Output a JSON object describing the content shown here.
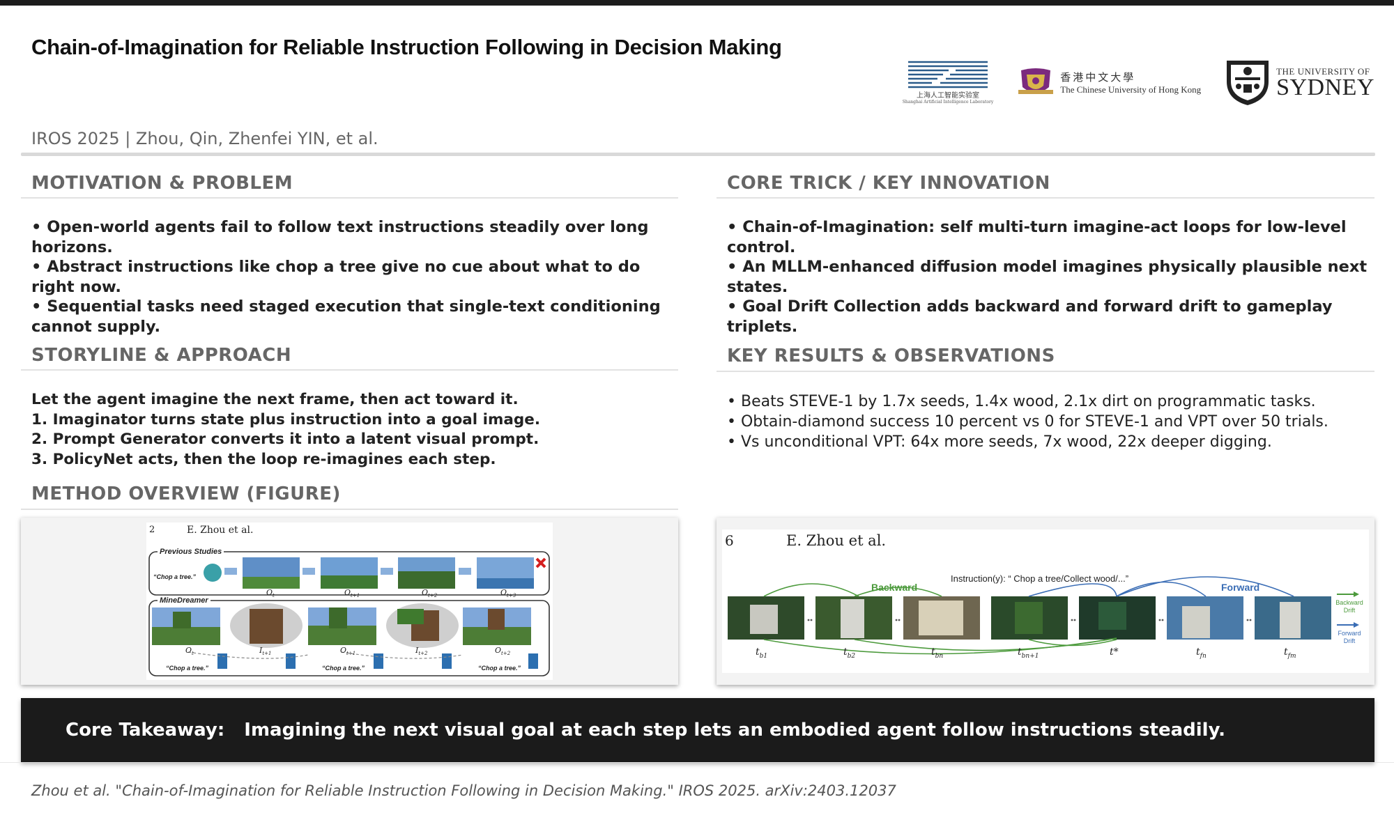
{
  "header": {
    "title": "Chain-of-Imagination for Reliable Instruction Following in Decision Making",
    "subtitle": "IROS 2025 | Zhou, Qin, Zhenfei YIN, et al."
  },
  "logos": {
    "shlab": {
      "zh": "上海人工智能实验室",
      "en": "Shanghai Artificial Intelligence Laboratory"
    },
    "cuhk": {
      "zh": "香港中文大學",
      "en": "The Chinese University of Hong Kong"
    },
    "sydney": {
      "line1": "THE UNIVERSITY OF",
      "line2": "SYDNEY"
    }
  },
  "motivation": {
    "heading": "MOTIVATION & PROBLEM",
    "bullets": [
      "•  Open-world agents fail to follow text instructions steadily over long horizons.",
      "•  Abstract instructions like chop a tree give no cue about what to do right now.",
      "•  Sequential tasks need staged execution that single-text conditioning cannot supply."
    ]
  },
  "storyline": {
    "heading": "STORYLINE & APPROACH",
    "lines": [
      "Let the agent imagine the next frame, then act toward it.",
      "1. Imaginator turns state plus instruction into a goal image.",
      "2. Prompt Generator converts it into a latent visual prompt.",
      "3. PolicyNet acts, then the loop re-imagines each step."
    ]
  },
  "method": {
    "heading": "METHOD OVERVIEW (FIGURE)"
  },
  "core": {
    "heading": "CORE TRICK / KEY INNOVATION",
    "bullets": [
      "•  Chain-of-Imagination: self multi-turn imagine-act loops for low-level control.",
      "•  An MLLM-enhanced diffusion model imagines physically plausible next states.",
      "•  Goal Drift Collection adds backward and forward drift to gameplay triplets."
    ]
  },
  "results": {
    "heading": "KEY RESULTS & OBSERVATIONS",
    "bullets": [
      "•  Beats STEVE-1 by 1.7x seeds, 1.4x wood, 2.1x dirt on programmatic tasks.",
      "•  Obtain-diamond success 10 percent vs 0 for STEVE-1 and VPT over 50 trials.",
      "•  Vs unconditional VPT: 64x more seeds, 7x wood, 22x deeper digging."
    ]
  },
  "figure_left": {
    "page_no": "2",
    "author": "E. Zhou et al.",
    "row1_label": "Previous Studies",
    "row2_label": "MineDreamer",
    "chop": "“Chop a tree.”",
    "o_labels": [
      "O",
      "O",
      "O",
      "O"
    ],
    "o_subs": [
      "t",
      "t+1",
      "t+2",
      "t+3"
    ],
    "o2_labels": [
      "O",
      "I",
      "O",
      "I",
      "O"
    ],
    "o2_subs": [
      "t",
      "t+1",
      "t+1",
      "t+2",
      "t+2"
    ]
  },
  "figure_right": {
    "page_no": "6",
    "author": "E. Zhou et al.",
    "instruction": "Instruction(y): “ Chop a tree/Collect wood/...”",
    "backward": "Backward",
    "forward": "Forward",
    "legend_backward": [
      "Backward",
      "Drift"
    ],
    "legend_forward": [
      "Forward",
      "Drift"
    ],
    "t_base": [
      "t",
      "t",
      "t",
      "t",
      "t*",
      "t",
      "t"
    ],
    "t_subs": [
      "b1",
      "b2",
      "bn",
      "bn+1",
      "",
      "fn",
      "fm"
    ]
  },
  "takeaway": {
    "label": "Core Takeaway:",
    "text": "Imagining the next visual goal at each step lets an embodied agent follow instructions steadily."
  },
  "citation": "Zhou et al. \"Chain-of-Imagination for Reliable Instruction Following in Decision Making.\" IROS 2025. arXiv:2403.12037",
  "colors": {
    "dark": "#1b1b1b",
    "heading_gray": "#666666",
    "backward_green": "#4c9a3c",
    "forward_blue": "#3a6db5"
  }
}
